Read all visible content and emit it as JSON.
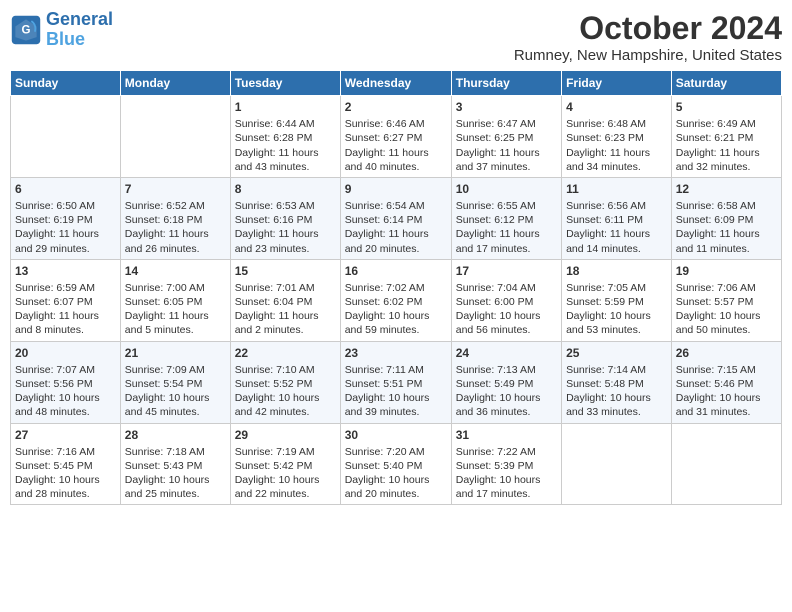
{
  "header": {
    "logo_line1": "General",
    "logo_line2": "Blue",
    "title": "October 2024",
    "location": "Rumney, New Hampshire, United States"
  },
  "weekdays": [
    "Sunday",
    "Monday",
    "Tuesday",
    "Wednesday",
    "Thursday",
    "Friday",
    "Saturday"
  ],
  "weeks": [
    [
      {
        "day": "",
        "empty": true
      },
      {
        "day": "",
        "empty": true
      },
      {
        "day": "1",
        "sunrise": "Sunrise: 6:44 AM",
        "sunset": "Sunset: 6:28 PM",
        "daylight": "Daylight: 11 hours and 43 minutes."
      },
      {
        "day": "2",
        "sunrise": "Sunrise: 6:46 AM",
        "sunset": "Sunset: 6:27 PM",
        "daylight": "Daylight: 11 hours and 40 minutes."
      },
      {
        "day": "3",
        "sunrise": "Sunrise: 6:47 AM",
        "sunset": "Sunset: 6:25 PM",
        "daylight": "Daylight: 11 hours and 37 minutes."
      },
      {
        "day": "4",
        "sunrise": "Sunrise: 6:48 AM",
        "sunset": "Sunset: 6:23 PM",
        "daylight": "Daylight: 11 hours and 34 minutes."
      },
      {
        "day": "5",
        "sunrise": "Sunrise: 6:49 AM",
        "sunset": "Sunset: 6:21 PM",
        "daylight": "Daylight: 11 hours and 32 minutes."
      }
    ],
    [
      {
        "day": "6",
        "sunrise": "Sunrise: 6:50 AM",
        "sunset": "Sunset: 6:19 PM",
        "daylight": "Daylight: 11 hours and 29 minutes."
      },
      {
        "day": "7",
        "sunrise": "Sunrise: 6:52 AM",
        "sunset": "Sunset: 6:18 PM",
        "daylight": "Daylight: 11 hours and 26 minutes."
      },
      {
        "day": "8",
        "sunrise": "Sunrise: 6:53 AM",
        "sunset": "Sunset: 6:16 PM",
        "daylight": "Daylight: 11 hours and 23 minutes."
      },
      {
        "day": "9",
        "sunrise": "Sunrise: 6:54 AM",
        "sunset": "Sunset: 6:14 PM",
        "daylight": "Daylight: 11 hours and 20 minutes."
      },
      {
        "day": "10",
        "sunrise": "Sunrise: 6:55 AM",
        "sunset": "Sunset: 6:12 PM",
        "daylight": "Daylight: 11 hours and 17 minutes."
      },
      {
        "day": "11",
        "sunrise": "Sunrise: 6:56 AM",
        "sunset": "Sunset: 6:11 PM",
        "daylight": "Daylight: 11 hours and 14 minutes."
      },
      {
        "day": "12",
        "sunrise": "Sunrise: 6:58 AM",
        "sunset": "Sunset: 6:09 PM",
        "daylight": "Daylight: 11 hours and 11 minutes."
      }
    ],
    [
      {
        "day": "13",
        "sunrise": "Sunrise: 6:59 AM",
        "sunset": "Sunset: 6:07 PM",
        "daylight": "Daylight: 11 hours and 8 minutes."
      },
      {
        "day": "14",
        "sunrise": "Sunrise: 7:00 AM",
        "sunset": "Sunset: 6:05 PM",
        "daylight": "Daylight: 11 hours and 5 minutes."
      },
      {
        "day": "15",
        "sunrise": "Sunrise: 7:01 AM",
        "sunset": "Sunset: 6:04 PM",
        "daylight": "Daylight: 11 hours and 2 minutes."
      },
      {
        "day": "16",
        "sunrise": "Sunrise: 7:02 AM",
        "sunset": "Sunset: 6:02 PM",
        "daylight": "Daylight: 10 hours and 59 minutes."
      },
      {
        "day": "17",
        "sunrise": "Sunrise: 7:04 AM",
        "sunset": "Sunset: 6:00 PM",
        "daylight": "Daylight: 10 hours and 56 minutes."
      },
      {
        "day": "18",
        "sunrise": "Sunrise: 7:05 AM",
        "sunset": "Sunset: 5:59 PM",
        "daylight": "Daylight: 10 hours and 53 minutes."
      },
      {
        "day": "19",
        "sunrise": "Sunrise: 7:06 AM",
        "sunset": "Sunset: 5:57 PM",
        "daylight": "Daylight: 10 hours and 50 minutes."
      }
    ],
    [
      {
        "day": "20",
        "sunrise": "Sunrise: 7:07 AM",
        "sunset": "Sunset: 5:56 PM",
        "daylight": "Daylight: 10 hours and 48 minutes."
      },
      {
        "day": "21",
        "sunrise": "Sunrise: 7:09 AM",
        "sunset": "Sunset: 5:54 PM",
        "daylight": "Daylight: 10 hours and 45 minutes."
      },
      {
        "day": "22",
        "sunrise": "Sunrise: 7:10 AM",
        "sunset": "Sunset: 5:52 PM",
        "daylight": "Daylight: 10 hours and 42 minutes."
      },
      {
        "day": "23",
        "sunrise": "Sunrise: 7:11 AM",
        "sunset": "Sunset: 5:51 PM",
        "daylight": "Daylight: 10 hours and 39 minutes."
      },
      {
        "day": "24",
        "sunrise": "Sunrise: 7:13 AM",
        "sunset": "Sunset: 5:49 PM",
        "daylight": "Daylight: 10 hours and 36 minutes."
      },
      {
        "day": "25",
        "sunrise": "Sunrise: 7:14 AM",
        "sunset": "Sunset: 5:48 PM",
        "daylight": "Daylight: 10 hours and 33 minutes."
      },
      {
        "day": "26",
        "sunrise": "Sunrise: 7:15 AM",
        "sunset": "Sunset: 5:46 PM",
        "daylight": "Daylight: 10 hours and 31 minutes."
      }
    ],
    [
      {
        "day": "27",
        "sunrise": "Sunrise: 7:16 AM",
        "sunset": "Sunset: 5:45 PM",
        "daylight": "Daylight: 10 hours and 28 minutes."
      },
      {
        "day": "28",
        "sunrise": "Sunrise: 7:18 AM",
        "sunset": "Sunset: 5:43 PM",
        "daylight": "Daylight: 10 hours and 25 minutes."
      },
      {
        "day": "29",
        "sunrise": "Sunrise: 7:19 AM",
        "sunset": "Sunset: 5:42 PM",
        "daylight": "Daylight: 10 hours and 22 minutes."
      },
      {
        "day": "30",
        "sunrise": "Sunrise: 7:20 AM",
        "sunset": "Sunset: 5:40 PM",
        "daylight": "Daylight: 10 hours and 20 minutes."
      },
      {
        "day": "31",
        "sunrise": "Sunrise: 7:22 AM",
        "sunset": "Sunset: 5:39 PM",
        "daylight": "Daylight: 10 hours and 17 minutes."
      },
      {
        "day": "",
        "empty": true
      },
      {
        "day": "",
        "empty": true
      }
    ]
  ]
}
